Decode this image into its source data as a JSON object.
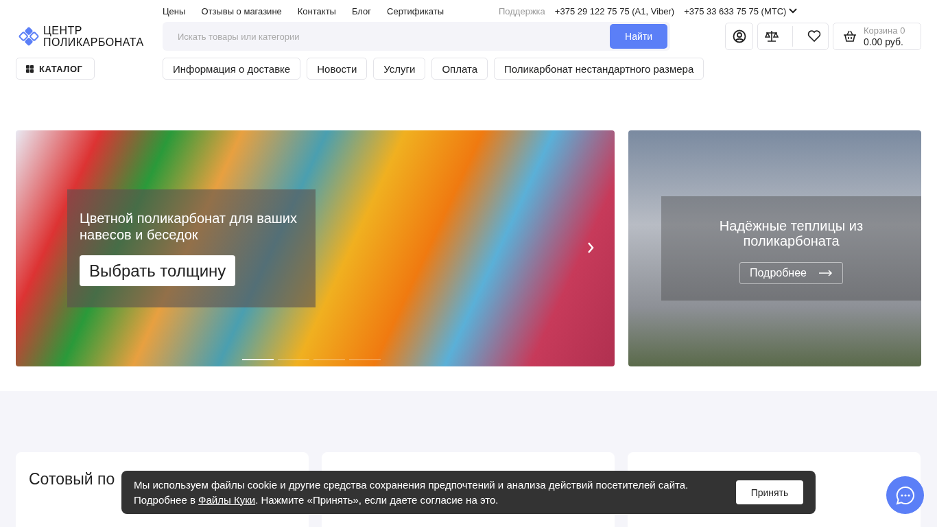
{
  "top_links": [
    "Цены",
    "Отзывы о магазине",
    "Контакты",
    "Блог",
    "Сертификаты"
  ],
  "support": {
    "label": "Поддержка",
    "phones": [
      "+375 29 122 75 75 (A1, Viber)",
      "+375 33 633 75 75 (МТС)"
    ]
  },
  "logo": {
    "line_1": "ЦЕНТР",
    "line_2": "ПОЛИКАРБОНАТА"
  },
  "search": {
    "placeholder": "Искать товары или категории",
    "button": "Найти"
  },
  "cart": {
    "label": "Корзина 0",
    "total": "0.00 руб."
  },
  "catalog_button": "КАТАЛОГ",
  "nav_pills": [
    "Информация о доставке",
    "Новости",
    "Услуги",
    "Оплата",
    "Поликарбонат нестандартного размера"
  ],
  "main_banner": {
    "title": "Цветной поликарбонат для ваших навесов и беседок",
    "button": "Выбрать толщину",
    "dots": [
      {
        "selected": true
      },
      {
        "selected": false
      },
      {
        "selected": false
      },
      {
        "selected": false
      }
    ]
  },
  "side_banner": {
    "title": "Надёжные теплицы из поликарбоната",
    "button": "Подробнее"
  },
  "card_titles": [
    "Сотовый по"
  ],
  "cookie": {
    "text_before": "Мы используем файлы cookie и другие средства сохранения предпочтений и анализа действий посетителей сайта. Подробнее в ",
    "link": "Файлы Куки",
    "text_after": ". Нажмите «Принять», если даете согласие на это.",
    "button": "Принять"
  }
}
